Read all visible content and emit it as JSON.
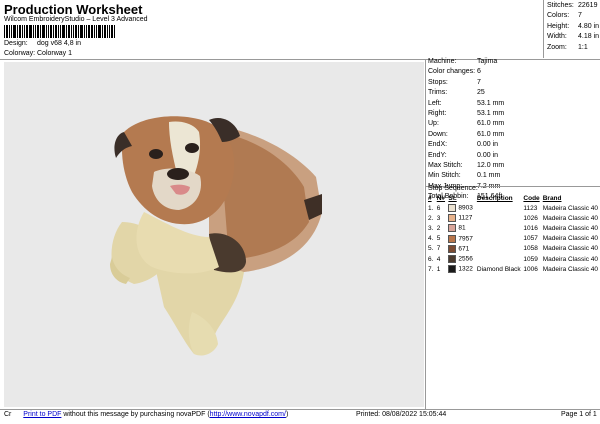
{
  "header": {
    "title": "Production Worksheet",
    "subtitle": "Wilcom EmbroideryStudio – Level 3 Advanced",
    "design_label": "Design:",
    "design_value": "dog v68 4,8 in",
    "colorway_label": "Colorway:",
    "colorway_value": "Colorway 1"
  },
  "stats": [
    {
      "label": "Stitches:",
      "value": "22619"
    },
    {
      "label": "Colors:",
      "value": "7"
    },
    {
      "label": "Height:",
      "value": "4.80 in"
    },
    {
      "label": "Width:",
      "value": "4.18 in"
    },
    {
      "label": "Zoom:",
      "value": "1:1"
    }
  ],
  "machine": [
    {
      "label": "Machine:",
      "value": "Tajima"
    },
    {
      "label": "Color changes:",
      "value": "6"
    },
    {
      "label": "Stops:",
      "value": "7"
    },
    {
      "label": "Trims:",
      "value": "25"
    },
    {
      "label": "Left:",
      "value": "53.1 mm"
    },
    {
      "label": "Right:",
      "value": "53.1 mm"
    },
    {
      "label": "Up:",
      "value": "61.0 mm"
    },
    {
      "label": "Down:",
      "value": "61.0 mm"
    },
    {
      "label": "EndX:",
      "value": "0.00 in"
    },
    {
      "label": "EndY:",
      "value": "0.00 in"
    },
    {
      "label": "Max Stitch:",
      "value": "12.0 mm"
    },
    {
      "label": "Min Stitch:",
      "value": "0.1 mm"
    },
    {
      "label": "Max Jump:",
      "value": "7.2 mm"
    },
    {
      "label": "Total Bobbin:",
      "value": "151.64ft"
    }
  ],
  "sequence": {
    "title": "Stop Sequence:",
    "headers": [
      "#",
      "N#",
      "St.",
      "Description",
      "Code",
      "Brand"
    ],
    "rows": [
      {
        "stop": "1.",
        "n": "6",
        "color": "#ece3d2",
        "st": "8903",
        "desc": "",
        "code": "1123",
        "brand": "Madeira Classic 40"
      },
      {
        "stop": "2.",
        "n": "3",
        "color": "#e8b38c",
        "st": "1127",
        "desc": "",
        "code": "1026",
        "brand": "Madeira Classic 40"
      },
      {
        "stop": "3.",
        "n": "2",
        "color": "#d9a59a",
        "st": "81",
        "desc": "",
        "code": "1016",
        "brand": "Madeira Classic 40"
      },
      {
        "stop": "4.",
        "n": "5",
        "color": "#b8754a",
        "st": "7957",
        "desc": "",
        "code": "1057",
        "brand": "Madeira Classic 40"
      },
      {
        "stop": "5.",
        "n": "7",
        "color": "#7a4a32",
        "st": "671",
        "desc": "",
        "code": "1058",
        "brand": "Madeira Classic 40"
      },
      {
        "stop": "6.",
        "n": "4",
        "color": "#4a3a2e",
        "st": "2556",
        "desc": "",
        "code": "1059",
        "brand": "Madeira Classic 40"
      },
      {
        "stop": "7.",
        "n": "1",
        "color": "#1a1a1a",
        "st": "1322",
        "desc": "Diamond Black",
        "code": "1006",
        "brand": "Madeira Classic 40"
      }
    ]
  },
  "footer": {
    "prefix": "Cr",
    "link1": "Print to PDF",
    "middle": " without this message by purchasing novaPDF (",
    "link2": "http://www.novapdf.com/",
    "suffix": ")",
    "printed": "Printed: 08/08/2022 15:05:44",
    "page": "Page 1 of 1"
  }
}
